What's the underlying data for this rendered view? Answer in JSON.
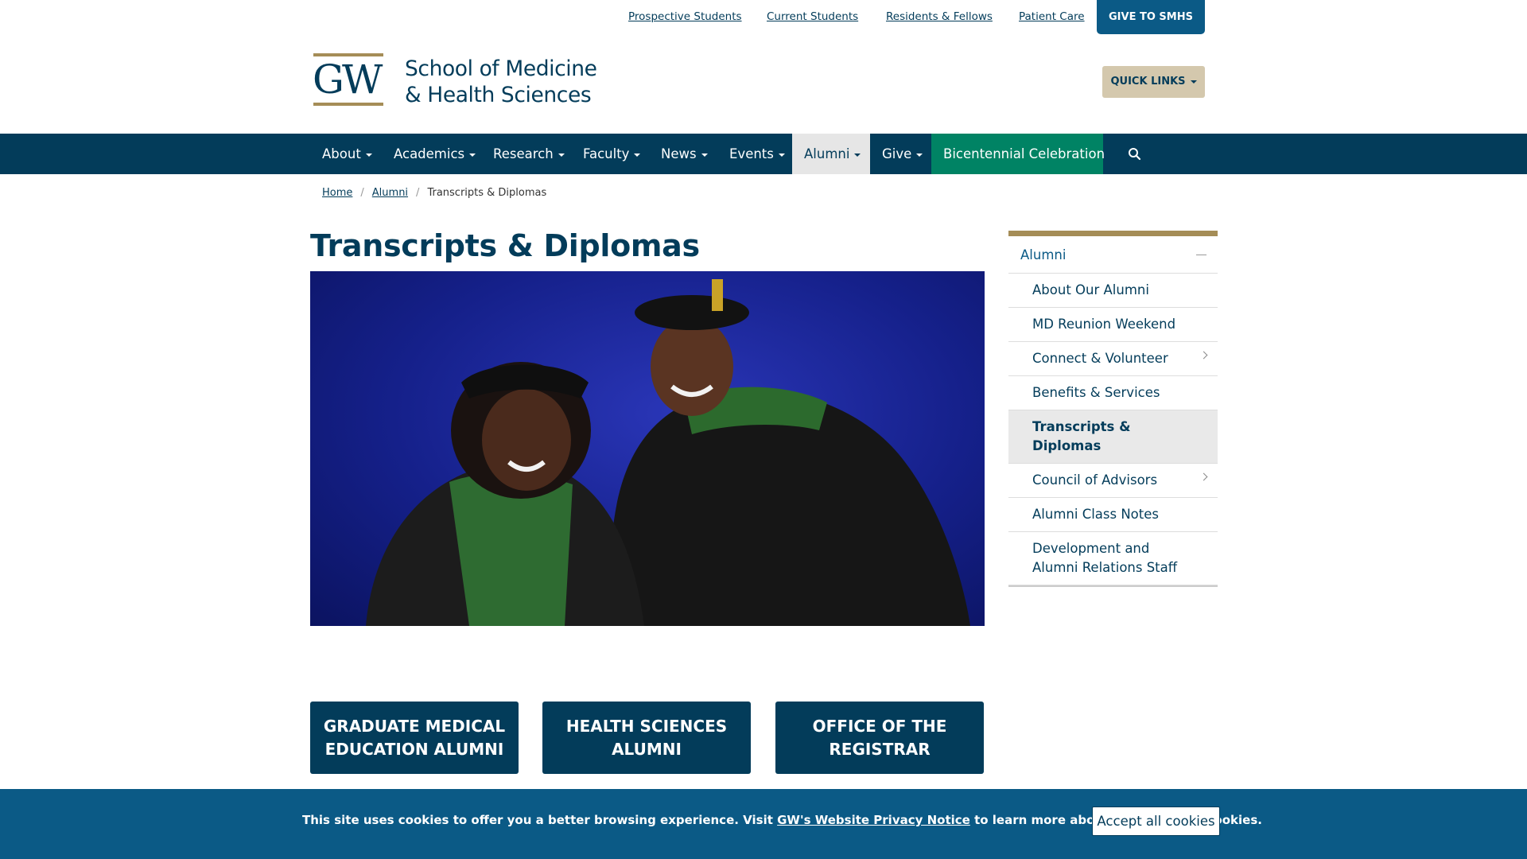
{
  "utility_nav": {
    "items": [
      "Prospective Students",
      "Current Students",
      "Residents & Fellows",
      "Patient Care"
    ],
    "give_label": "GIVE TO SMHS"
  },
  "header": {
    "logo_letters": "GW",
    "logo_line1": "School of Medicine",
    "logo_line2": "& Health Sciences",
    "quick_links_label": "QUICK LINKS"
  },
  "main_nav": {
    "items": [
      "About",
      "Academics",
      "Research",
      "Faculty",
      "News",
      "Events",
      "Alumni",
      "Give",
      "Bicentennial Celebration"
    ],
    "active": "Alumni",
    "highlight": "Bicentennial Celebration",
    "search_icon": "search-icon"
  },
  "breadcrumb": [
    "Home",
    "Alumni",
    "Transcripts & Diplomas"
  ],
  "page": {
    "title": "Transcripts & Diplomas",
    "hero_image": "graduates-in-regalia-photo"
  },
  "cta_buttons": [
    "GRADUATE MEDICAL EDUCATION ALUMNI",
    "HEALTH SCIENCES ALUMNI",
    "OFFICE OF THE REGISTRAR"
  ],
  "sidebar": {
    "heading": "Alumni",
    "items": [
      {
        "label": "About Our Alumni",
        "has_children": false
      },
      {
        "label": "MD Reunion Weekend",
        "has_children": false
      },
      {
        "label": "Connect & Volunteer",
        "has_children": true
      },
      {
        "label": "Benefits & Services",
        "has_children": false
      },
      {
        "label": "Transcripts & Diplomas",
        "has_children": false,
        "current": true
      },
      {
        "label": "Council of Advisors",
        "has_children": true
      },
      {
        "label": "Alumni Class Notes",
        "has_children": false
      },
      {
        "label": "Development and Alumni Relations Staff",
        "has_children": false
      }
    ]
  },
  "cookie_banner": {
    "text_before": "This site uses cookies to offer you a better browsing experience. Visit ",
    "link_text": "GW's Website Privacy Notice",
    "text_after": " to learn more about how GW uses cookies.",
    "button_label": "Accept all cookies"
  },
  "colors": {
    "navy": "#033c5a",
    "gold": "#a58d57",
    "green": "#008364",
    "blue": "#0b5a86",
    "tan": "#d4c8ad"
  }
}
